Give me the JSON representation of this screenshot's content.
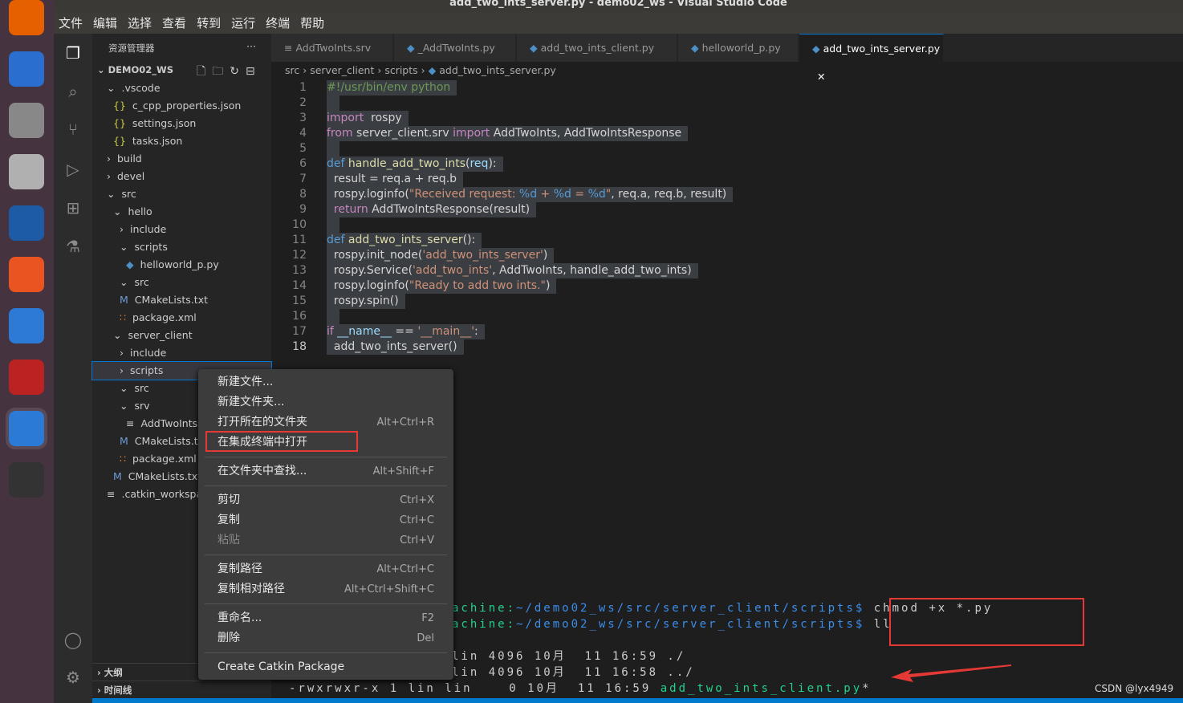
{
  "window_title": "add_two_ints_server.py - demo02_ws - Visual Studio Code",
  "menu": [
    "文件",
    "编辑",
    "选择",
    "查看",
    "转到",
    "运行",
    "终端",
    "帮助"
  ],
  "dock": [
    "firefox-icon",
    "thunderbird-icon",
    "files-icon",
    "rhythmbox-icon",
    "writer-icon",
    "software-icon",
    "help-icon",
    "terminal-app-icon",
    "vscode-icon",
    "terminal-icon"
  ],
  "sidebar": {
    "title": "资源管理器",
    "more": "···",
    "root": "DEMO02_WS",
    "items": [
      {
        "label": ".vscode",
        "icon": "⌄",
        "depth": 1
      },
      {
        "label": "c_cpp_properties.json",
        "icon": "{}",
        "depth": 2
      },
      {
        "label": "settings.json",
        "icon": "{}",
        "depth": 2
      },
      {
        "label": "tasks.json",
        "icon": "{}",
        "depth": 2
      },
      {
        "label": "build",
        "icon": "›",
        "depth": 1
      },
      {
        "label": "devel",
        "icon": "›",
        "depth": 1
      },
      {
        "label": "src",
        "icon": "⌄",
        "depth": 1
      },
      {
        "label": "hello",
        "icon": "⌄",
        "depth": 2
      },
      {
        "label": "include",
        "icon": "›",
        "depth": 3
      },
      {
        "label": "scripts",
        "icon": "⌄",
        "depth": 3
      },
      {
        "label": "helloworld_p.py",
        "icon": "py",
        "depth": 4
      },
      {
        "label": "src",
        "icon": "⌄",
        "depth": 3
      },
      {
        "label": "CMakeLists.txt",
        "icon": "M",
        "depth": 3
      },
      {
        "label": "package.xml",
        "icon": "rss",
        "depth": 3
      },
      {
        "label": "server_client",
        "icon": "⌄",
        "depth": 2
      },
      {
        "label": "include",
        "icon": "›",
        "depth": 3
      },
      {
        "label": "scripts",
        "icon": "›",
        "depth": 3,
        "selected": true
      },
      {
        "label": "src",
        "icon": "⌄",
        "depth": 3
      },
      {
        "label": "srv",
        "icon": "⌄",
        "depth": 3
      },
      {
        "label": "AddTwoInts.srv",
        "icon": "≡",
        "depth": 4
      },
      {
        "label": "CMakeLists.txt",
        "icon": "M",
        "depth": 3
      },
      {
        "label": "package.xml",
        "icon": "rss",
        "depth": 3
      },
      {
        "label": "CMakeLists.txt",
        "icon": "M",
        "depth": 2
      },
      {
        "label": ".catkin_workspace",
        "icon": "≡",
        "depth": 1
      }
    ],
    "outline": "大纲",
    "timeline": "时间线"
  },
  "tabs": [
    {
      "label": "AddTwoInts.srv",
      "icon": "≡"
    },
    {
      "label": "_AddTwoInts.py",
      "icon": "py"
    },
    {
      "label": "add_two_ints_client.py",
      "icon": "py"
    },
    {
      "label": "helloworld_p.py",
      "icon": "py"
    },
    {
      "label": "add_two_ints_server.py",
      "icon": "py",
      "active": true
    }
  ],
  "breadcrumb": [
    "src",
    "server_client",
    "scripts",
    "add_two_ints_server.py"
  ],
  "code": [
    [
      [
        "cm",
        "#!/usr/bin/env python"
      ]
    ],
    [],
    [
      [
        "kw",
        "import"
      ],
      [
        "",
        "  rospy"
      ]
    ],
    [
      [
        "kw",
        "from"
      ],
      [
        "",
        " server_client.srv "
      ],
      [
        "kw",
        "import"
      ],
      [
        "",
        " AddTwoInts, AddTwoIntsResponse"
      ]
    ],
    [],
    [
      [
        "df",
        "def"
      ],
      [
        "fn",
        " handle_add_two_ints"
      ],
      [
        "",
        "("
      ],
      [
        "pm",
        "req"
      ],
      [
        "",
        "):"
      ]
    ],
    [
      [
        "",
        "  result = req.a + req.b"
      ]
    ],
    [
      [
        "",
        "  rospy.loginfo("
      ],
      [
        "st",
        "\"Received request: "
      ],
      [
        "df",
        "%d"
      ],
      [
        "st",
        " + "
      ],
      [
        "df",
        "%d"
      ],
      [
        "st",
        " = "
      ],
      [
        "df",
        "%d"
      ],
      [
        "st",
        "\""
      ],
      [
        "",
        ", req.a, req.b, result)"
      ]
    ],
    [
      [
        "kw",
        "  return"
      ],
      [
        "",
        " AddTwoIntsResponse(result)"
      ]
    ],
    [],
    [
      [
        "df",
        "def"
      ],
      [
        "fn",
        " add_two_ints_server"
      ],
      [
        "",
        "():"
      ]
    ],
    [
      [
        "",
        "  rospy.init_node("
      ],
      [
        "st",
        "'add_two_ints_server'"
      ],
      [
        "",
        ")"
      ]
    ],
    [
      [
        "",
        "  rospy.Service("
      ],
      [
        "st",
        "'add_two_ints'"
      ],
      [
        "",
        ", AddTwoInts, handle_add_two_ints)"
      ]
    ],
    [
      [
        "",
        "  rospy.loginfo("
      ],
      [
        "st",
        "\"Ready to add two ints.\""
      ],
      [
        "",
        ")"
      ]
    ],
    [
      [
        "",
        "  rospy.spin()"
      ]
    ],
    [],
    [
      [
        "kw",
        "if"
      ],
      [
        "pm",
        " __name__"
      ],
      [
        "",
        " == "
      ],
      [
        "st",
        "'__main__'"
      ],
      [
        "",
        ":"
      ]
    ],
    [
      [
        "",
        "  add_two_ints_server()"
      ]
    ]
  ],
  "context_menu": [
    {
      "label": "新建文件...",
      "key": ""
    },
    {
      "label": "新建文件夹...",
      "key": ""
    },
    {
      "label": "打开所在的文件夹",
      "key": "Alt+Ctrl+R"
    },
    {
      "label": "在集成终端中打开",
      "key": "",
      "highlight": true
    },
    {
      "sep": true
    },
    {
      "label": "在文件夹中查找...",
      "key": "Alt+Shift+F"
    },
    {
      "sep": true
    },
    {
      "label": "剪切",
      "key": "Ctrl+X"
    },
    {
      "label": "复制",
      "key": "Ctrl+C"
    },
    {
      "label": "粘贴",
      "key": "Ctrl+V",
      "disabled": true
    },
    {
      "sep": true
    },
    {
      "label": "复制路径",
      "key": "Alt+Ctrl+C"
    },
    {
      "label": "复制相对路径",
      "key": "Alt+Ctrl+Shift+C"
    },
    {
      "sep": true
    },
    {
      "label": "重命名...",
      "key": "F2"
    },
    {
      "label": "删除",
      "key": "Del"
    },
    {
      "sep": true
    },
    {
      "label": "Create Catkin Package",
      "key": ""
    }
  ],
  "terminal": {
    "prompt_host": "achine:",
    "prompt_path": "~/demo02_ws/src/server_client/scripts$",
    "cmd1": " chmod +x *.py",
    "cmd2": " ll",
    "line3": "lin 4096 10月  11 16:59 ./",
    "line4": "lin 4096 10月  11 16:58 ../",
    "line5_meta": "-rwxrwxr-x 1 lin lin    0 10月  11 16:59 ",
    "line5_file": "add_two_ints_client.py",
    "line5_suffix": "*"
  },
  "watermark": "CSDN @lyx4949",
  "colors": {
    "accent": "#0078d4",
    "annotation": "#e53935"
  }
}
